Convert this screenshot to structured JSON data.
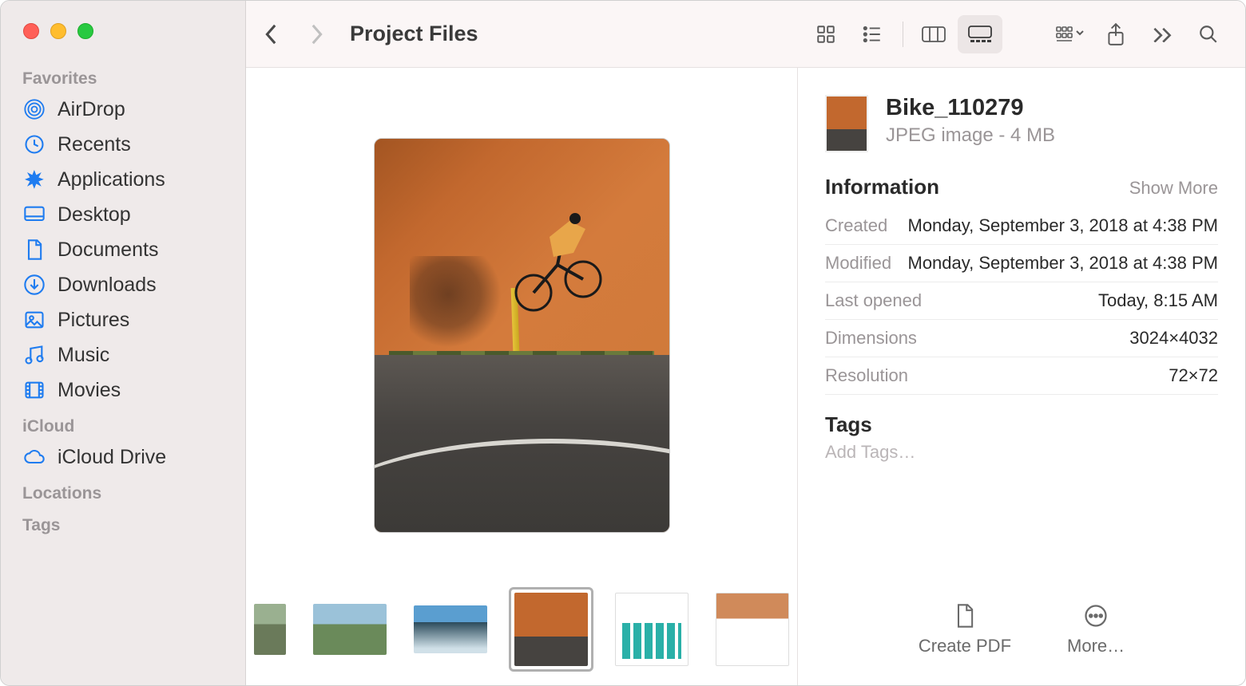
{
  "header": {
    "title": "Project Files"
  },
  "sidebar": {
    "sections": [
      {
        "header": "Favorites",
        "items": [
          {
            "icon": "airdrop-icon",
            "label": "AirDrop"
          },
          {
            "icon": "recents-icon",
            "label": "Recents"
          },
          {
            "icon": "applications-icon",
            "label": "Applications"
          },
          {
            "icon": "desktop-icon",
            "label": "Desktop"
          },
          {
            "icon": "documents-icon",
            "label": "Documents"
          },
          {
            "icon": "downloads-icon",
            "label": "Downloads"
          },
          {
            "icon": "pictures-icon",
            "label": "Pictures"
          },
          {
            "icon": "music-icon",
            "label": "Music"
          },
          {
            "icon": "movies-icon",
            "label": "Movies"
          }
        ]
      },
      {
        "header": "iCloud",
        "items": [
          {
            "icon": "cloud-icon",
            "label": "iCloud Drive"
          }
        ]
      },
      {
        "header": "Locations",
        "items": []
      },
      {
        "header": "Tags",
        "items": []
      }
    ]
  },
  "file": {
    "name": "Bike_110279",
    "subtitle": "JPEG image - 4 MB"
  },
  "info": {
    "sectionTitle": "Information",
    "showMore": "Show More",
    "rows": [
      {
        "label": "Created",
        "value": "Monday, September 3, 2018 at 4:38 PM"
      },
      {
        "label": "Modified",
        "value": "Monday, September 3, 2018 at 4:38 PM"
      },
      {
        "label": "Last opened",
        "value": "Today, 8:15 AM"
      },
      {
        "label": "Dimensions",
        "value": "3024×4032"
      },
      {
        "label": "Resolution",
        "value": "72×72"
      }
    ]
  },
  "tags": {
    "title": "Tags",
    "placeholder": "Add Tags…"
  },
  "actions": {
    "createPdf": "Create PDF",
    "more": "More…"
  },
  "thumbnails": [
    {
      "id": "t0",
      "selected": false
    },
    {
      "id": "t1",
      "selected": false
    },
    {
      "id": "t2",
      "selected": false
    },
    {
      "id": "t3",
      "selected": true
    },
    {
      "id": "t4",
      "selected": false
    },
    {
      "id": "t5",
      "selected": false
    }
  ]
}
